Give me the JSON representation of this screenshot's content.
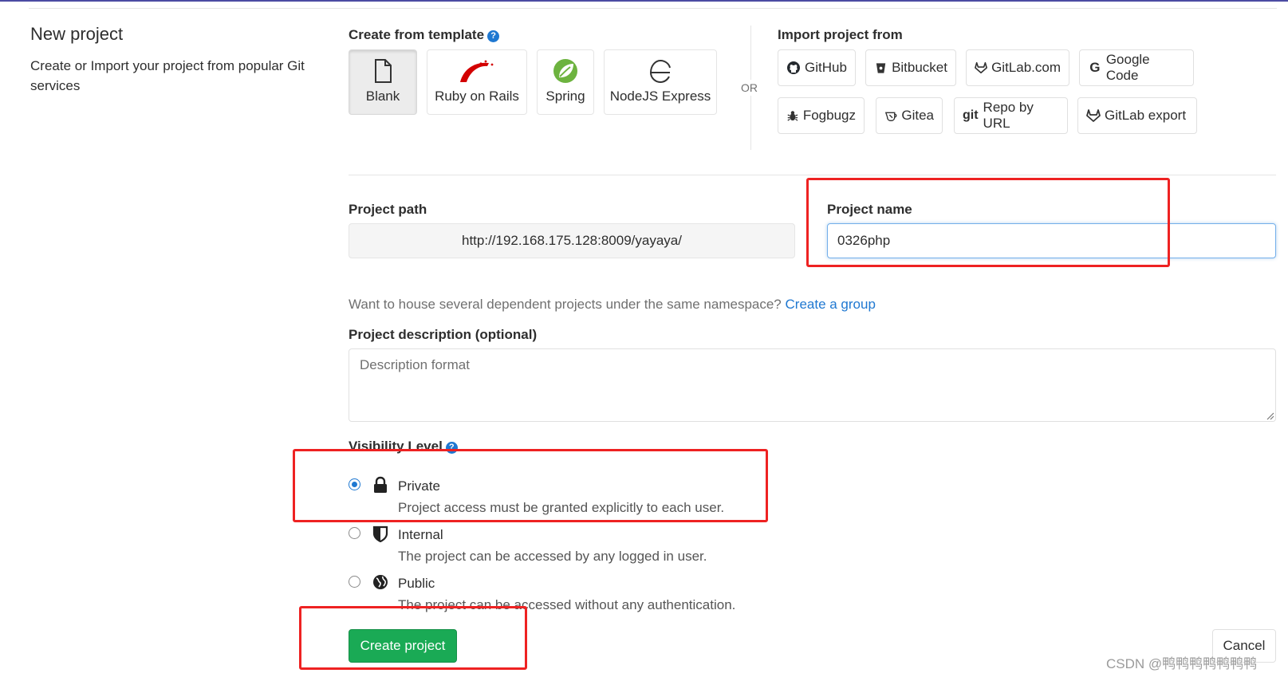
{
  "page": {
    "title": "New project",
    "subtitle": "Create or Import your project from popular Git services"
  },
  "template": {
    "heading": "Create from template",
    "items": [
      {
        "label": "Blank",
        "icon": "file-icon"
      },
      {
        "label": "Ruby on Rails",
        "icon": "rails-icon"
      },
      {
        "label": "Spring",
        "icon": "spring-leaf-icon"
      },
      {
        "label": "NodeJS Express",
        "icon": "express-e-icon"
      }
    ],
    "or_text": "OR"
  },
  "import": {
    "heading": "Import project from",
    "items": [
      {
        "label": "GitHub",
        "icon": "github-icon"
      },
      {
        "label": "Bitbucket",
        "icon": "bitbucket-icon"
      },
      {
        "label": "GitLab.com",
        "icon": "gitlab-icon"
      },
      {
        "label": "Google Code",
        "icon": "google-icon"
      },
      {
        "label": "Fogbugz",
        "icon": "bug-icon"
      },
      {
        "label": "Gitea",
        "icon": "gitea-icon"
      },
      {
        "label": "Repo by URL",
        "icon": "git-icon",
        "icon_text": "git"
      },
      {
        "label": "GitLab export",
        "icon": "gitlab-icon"
      }
    ]
  },
  "form": {
    "path_label": "Project path",
    "path_value": "http://192.168.175.128:8009/yayaya/",
    "name_label": "Project name",
    "name_value": "0326php",
    "group_hint": "Want to house several dependent projects under the same namespace?",
    "group_link": "Create a group",
    "description_label": "Project description (optional)",
    "description_placeholder": "Description format",
    "visibility_label": "Visibility Level",
    "visibility": [
      {
        "title": "Private",
        "desc": "Project access must be granted explicitly to each user.",
        "checked": true,
        "icon": "lock-icon"
      },
      {
        "title": "Internal",
        "desc": "The project can be accessed by any logged in user.",
        "checked": false,
        "icon": "shield-icon"
      },
      {
        "title": "Public",
        "desc": "The project can be accessed without any authentication.",
        "checked": false,
        "icon": "globe-icon"
      }
    ],
    "create_button": "Create project",
    "cancel_button": "Cancel"
  },
  "colors": {
    "accent": "#1f78d1",
    "success": "#1aaa55",
    "annotation": "#ee2222"
  },
  "watermark": "CSDN @鸭鸭鸭鸭鸭鸭鸭"
}
